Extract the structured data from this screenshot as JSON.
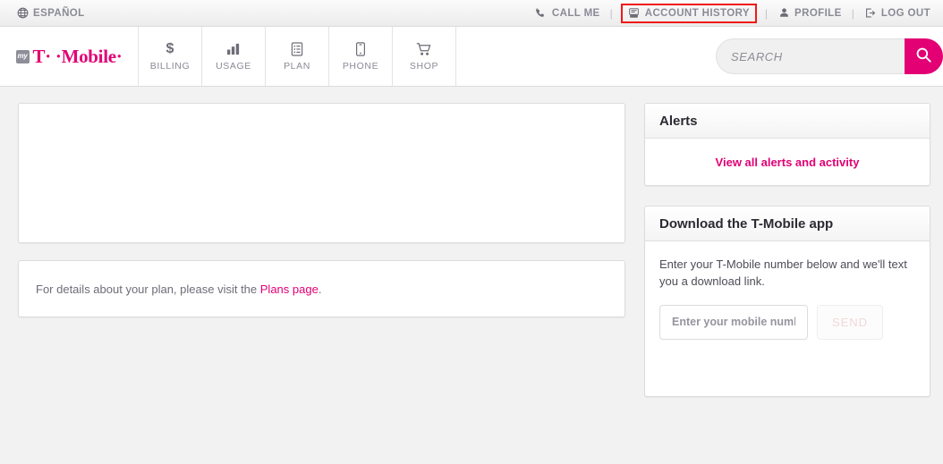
{
  "brand": {
    "magenta": "#e20074",
    "highlight_red": "#ef1a17",
    "logo_badge": "my",
    "logo_text": "T· ·Mobile·"
  },
  "utility_bar": {
    "espanol": {
      "label": "ESPAÑOL",
      "icon": "globe-icon"
    },
    "separator": "|",
    "links": [
      {
        "label": "CALL ME",
        "icon": "phone-icon",
        "highlighted": false
      },
      {
        "label": "ACCOUNT HISTORY",
        "icon": "account-history-icon",
        "highlighted": true
      },
      {
        "label": "PROFILE",
        "icon": "user-icon",
        "highlighted": false
      },
      {
        "label": "LOG OUT",
        "icon": "logout-icon",
        "highlighted": false
      }
    ]
  },
  "main_nav": {
    "items": [
      {
        "label": "BILLING",
        "icon": "dollar-icon"
      },
      {
        "label": "USAGE",
        "icon": "bar-chart-icon"
      },
      {
        "label": "PLAN",
        "icon": "document-icon"
      },
      {
        "label": "PHONE",
        "icon": "phone-device-icon"
      },
      {
        "label": "SHOP",
        "icon": "shopping-cart-icon"
      }
    ],
    "search": {
      "placeholder": "SEARCH",
      "value": "",
      "button_icon": "search-icon"
    }
  },
  "main": {
    "blank_card": {
      "content": ""
    },
    "plan_note": {
      "text_before": "For details about your plan, please visit the ",
      "link_text": "Plans page",
      "text_after": "."
    }
  },
  "sidebar": {
    "alerts_panel": {
      "title": "Alerts",
      "link_label": "View all alerts and activity"
    },
    "app_panel": {
      "title": "Download the T-Mobile app",
      "copy": "Enter your T-Mobile number below and we'll text you a download link.",
      "input_placeholder": "Enter your mobile number",
      "input_value": "",
      "send_label": "SEND"
    }
  }
}
